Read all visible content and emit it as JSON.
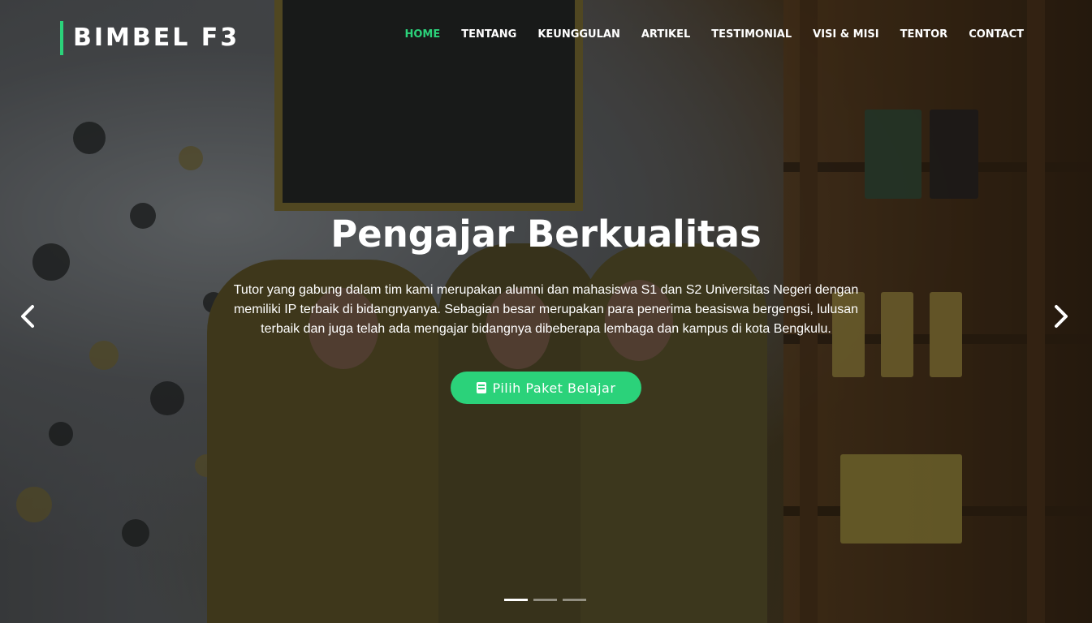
{
  "brand": {
    "name": "BIMBEL F3",
    "accent_color": "#2bd27a"
  },
  "nav": {
    "items": [
      {
        "label": "HOME",
        "active": true
      },
      {
        "label": "TENTANG",
        "active": false
      },
      {
        "label": "KEUNGGULAN",
        "active": false
      },
      {
        "label": "ARTIKEL",
        "active": false
      },
      {
        "label": "TESTIMONIAL",
        "active": false
      },
      {
        "label": "VISI & MISI",
        "active": false
      },
      {
        "label": "TENTOR",
        "active": false
      },
      {
        "label": "CONTACT",
        "active": false
      }
    ]
  },
  "slide": {
    "title": "Pengajar Berkualitas",
    "description": "Tutor yang gabung dalam tim kami merupakan alumni dan mahasiswa S1 dan S2 Universitas Negeri dengan memiliki IP terbaik di bidangnyanya. Sebagian besar merupakan para penerima beasiswa bergengsi, lulusan terbaik dan juga telah ada mengajar bidangnya dibeberapa lembaga dan kampus di kota Bengkulu.",
    "cta_label": "Pilih Paket Belajar",
    "cta_icon": "book-icon"
  },
  "carousel": {
    "slide_count": 3,
    "active_index": 0,
    "prev_icon": "chevron-left-icon",
    "next_icon": "chevron-right-icon"
  }
}
